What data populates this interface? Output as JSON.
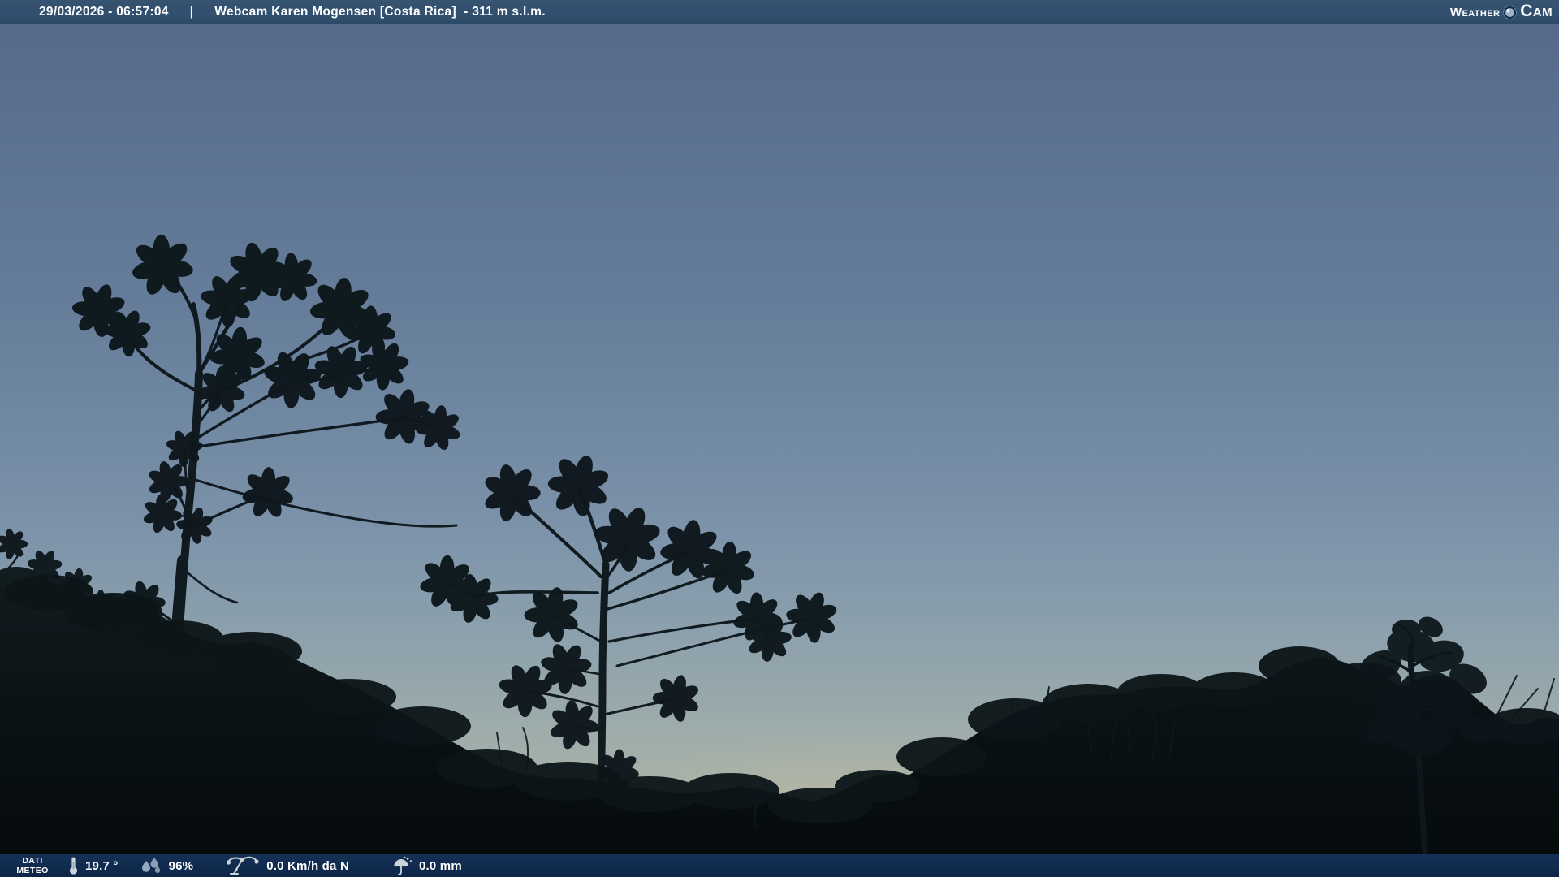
{
  "header": {
    "datetime": "29/03/2026 - 06:57:04",
    "separator": "|",
    "title": "Webcam Karen Mogensen [Costa Rica]  - 311 m s.l.m.",
    "logo_weather": "Weather",
    "logo_cam": "Cam"
  },
  "footer": {
    "label_line1": "DATI",
    "label_line2": "METEO",
    "temperature": "19.7 °",
    "humidity": "96%",
    "wind": "0.0 Km/h da N",
    "rain": "0.0 mm"
  },
  "colors": {
    "top_bar": "#32506f",
    "bottom_bar": "#0f2a4d",
    "sky_top": "#57698a",
    "sky_mid": "#7b92a9",
    "sky_horizon": "#b6bcaa",
    "silhouette": "#0d171c"
  }
}
